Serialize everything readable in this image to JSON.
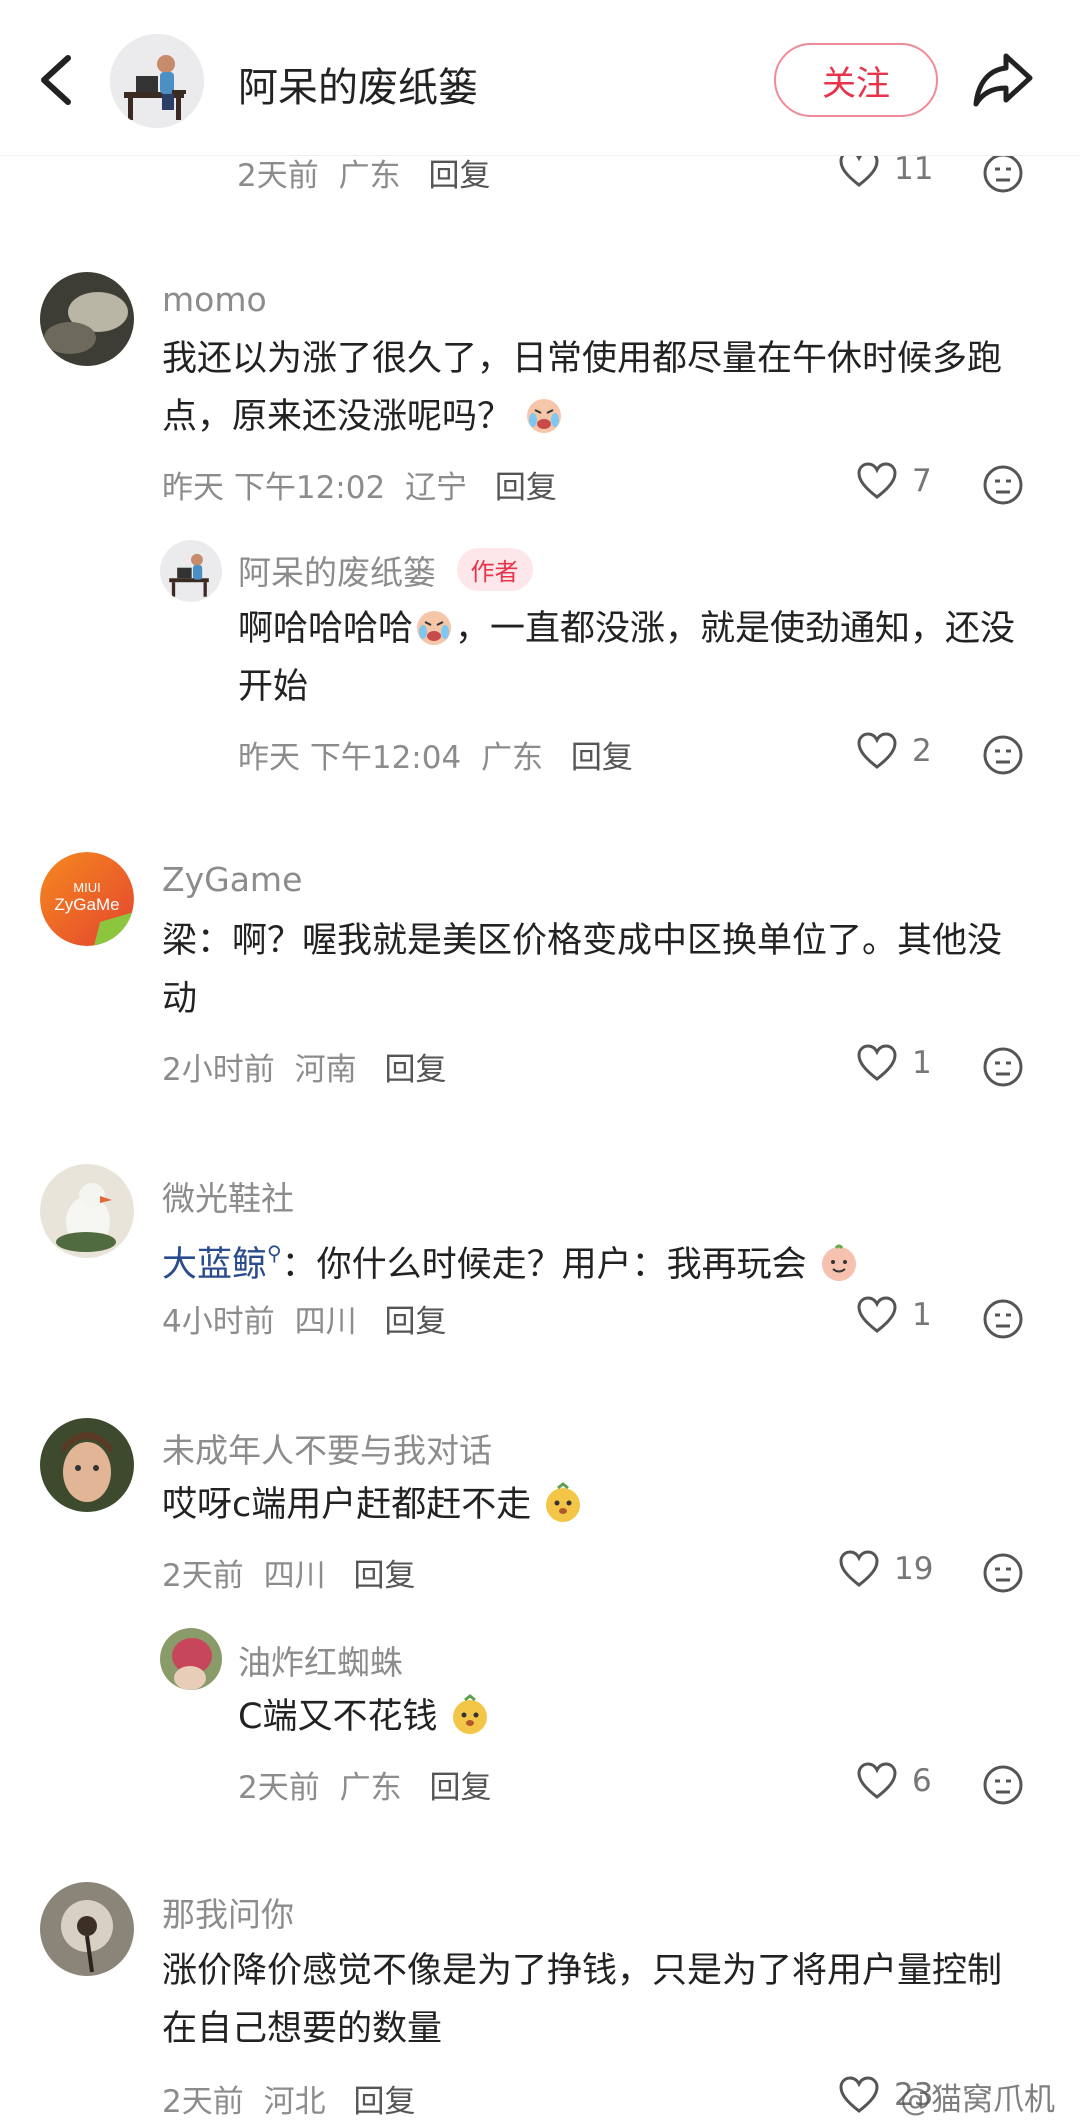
{
  "header": {
    "title": "阿呆的废纸篓",
    "follow_label": "关注"
  },
  "top_meta": {
    "time": "2天前",
    "location": "广东",
    "reply": "回复",
    "likes": "11"
  },
  "comments": [
    {
      "name": "momo",
      "text": "我还以为涨了很久了，日常使用都尽量在午休时候多跑点，原来还没涨呢吗？",
      "time": "昨天 下午12:02",
      "location": "辽宁",
      "reply": "回复",
      "likes": "7",
      "replies": [
        {
          "name": "阿呆的废纸篓",
          "badge": "作者",
          "text_a": "啊哈哈哈哈",
          "text_b": "，一直都没涨，就是使劲通知，还没开始",
          "time": "昨天 下午12:04",
          "location": "广东",
          "reply": "回复",
          "likes": "2"
        }
      ]
    },
    {
      "name": "ZyGame",
      "avatar_text_top": "MIUI",
      "avatar_text_bottom": "ZyGaMe",
      "text": "梁：啊？喔我就是美区价格变成中区换单位了。其他没动",
      "time": "2小时前",
      "location": "河南",
      "reply": "回复",
      "likes": "1"
    },
    {
      "name": "微光鞋社",
      "mention": "大蓝鲸",
      "text": "：你什么时候走？用户：我再玩会",
      "time": "4小时前",
      "location": "四川",
      "reply": "回复",
      "likes": "1"
    },
    {
      "name": "未成年人不要与我对话",
      "text": "哎呀c端用户赶都赶不走",
      "time": "2天前",
      "location": "四川",
      "reply": "回复",
      "likes": "19",
      "replies": [
        {
          "name": "油炸红蜘蛛",
          "text": "C端又不花钱",
          "time": "2天前",
          "location": "广东",
          "reply": "回复",
          "likes": "6"
        }
      ]
    },
    {
      "name": "那我问你",
      "text": "涨价降价感觉不像是为了挣钱，只是为了将用户量控制在自己想要的数量",
      "time": "2天前",
      "location": "河北",
      "reply": "回复",
      "likes": "23"
    }
  ],
  "watermark": "@猫窝爪机",
  "colors": {
    "accent": "#e8334a",
    "meta": "#8c8c8c",
    "mention": "#2a4b8d"
  }
}
